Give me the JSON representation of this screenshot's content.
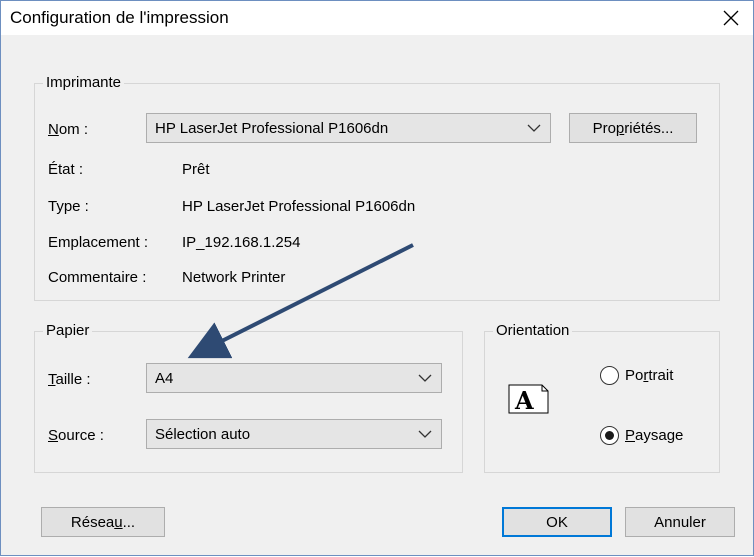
{
  "window": {
    "title": "Configuration de l'impression"
  },
  "printer": {
    "group_label": "Imprimante",
    "name_label_pre": "",
    "name_label_u": "N",
    "name_label_post": "om :",
    "name_value": "HP LaserJet Professional P1606dn",
    "properties_pre": "Pro",
    "properties_u": "p",
    "properties_post": "riétés...",
    "status_label": "État :",
    "status_value": "Prêt",
    "type_label": "Type :",
    "type_value": "HP LaserJet Professional P1606dn",
    "location_label": "Emplacement :",
    "location_value": "IP_192.168.1.254",
    "comment_label": "Commentaire :",
    "comment_value": "Network Printer"
  },
  "paper": {
    "group_label": "Papier",
    "size_label_u": "T",
    "size_label_post": "aille :",
    "size_value": "A4",
    "source_label_u": "S",
    "source_label_post": "ource :",
    "source_value": "Sélection auto"
  },
  "orientation": {
    "group_label": "Orientation",
    "icon_letter": "A",
    "portrait_pre": "Po",
    "portrait_u": "r",
    "portrait_post": "trait",
    "portrait_selected": false,
    "landscape_u": "P",
    "landscape_post": "aysage",
    "landscape_selected": true
  },
  "buttons": {
    "network_pre": "Résea",
    "network_u": "u",
    "network_post": "...",
    "ok": "OK",
    "cancel": "Annuler"
  },
  "annotation": {
    "arrow_color": "#2e4a73"
  }
}
